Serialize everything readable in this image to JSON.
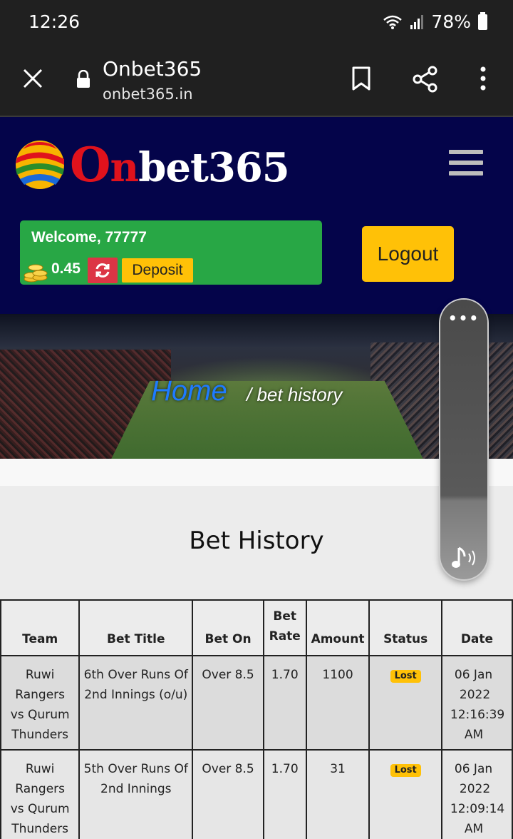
{
  "status_bar": {
    "time": "12:26",
    "battery": "78%"
  },
  "browser": {
    "title": "Onbet365",
    "url": "onbet365.in"
  },
  "site": {
    "logo_o": "O",
    "logo_n": "n",
    "logo_rest": "bet365",
    "welcome": "Welcome, 77777",
    "balance": "0.45",
    "deposit_label": "Deposit",
    "logout_label": "Logout"
  },
  "breadcrumb": {
    "home": "Home",
    "current": "/ bet history"
  },
  "page_title": "Bet History",
  "table": {
    "headers": [
      "Team",
      "Bet Title",
      "Bet On",
      "Bet Rate",
      "Amount",
      "Status",
      "Date"
    ],
    "header_bet_top": "Bet",
    "header_rate_bottom": "Rate",
    "rows": [
      {
        "team_lines": [
          "Ruwi",
          "Rangers",
          "vs Qurum",
          "Thunders"
        ],
        "title_lines": [
          "6th Over Runs Of",
          "2nd Innings (o/u)"
        ],
        "bet_on": "Over 8.5",
        "rate": "1.70",
        "amount": "1100",
        "status": "Lost",
        "date_lines": [
          "06 Jan",
          "2022",
          "12:16:39",
          "AM"
        ]
      },
      {
        "team_lines": [
          "Ruwi",
          "Rangers",
          "vs Qurum",
          "Thunders"
        ],
        "title_lines": [
          "5th Over Runs Of",
          "2nd Innings"
        ],
        "bet_on": "Over 8.5",
        "rate": "1.70",
        "amount": "31",
        "status": "Lost",
        "date_lines": [
          "06 Jan",
          "2022",
          "12:09:14",
          "AM"
        ]
      }
    ]
  },
  "floating_widget": {
    "dots": "•••"
  },
  "colors": {
    "header_bg": "#04044a",
    "welcome_bg": "#28a745",
    "accent_yellow": "#ffc107",
    "refresh_red": "#dc3545",
    "home_blue": "#1e7bff"
  }
}
